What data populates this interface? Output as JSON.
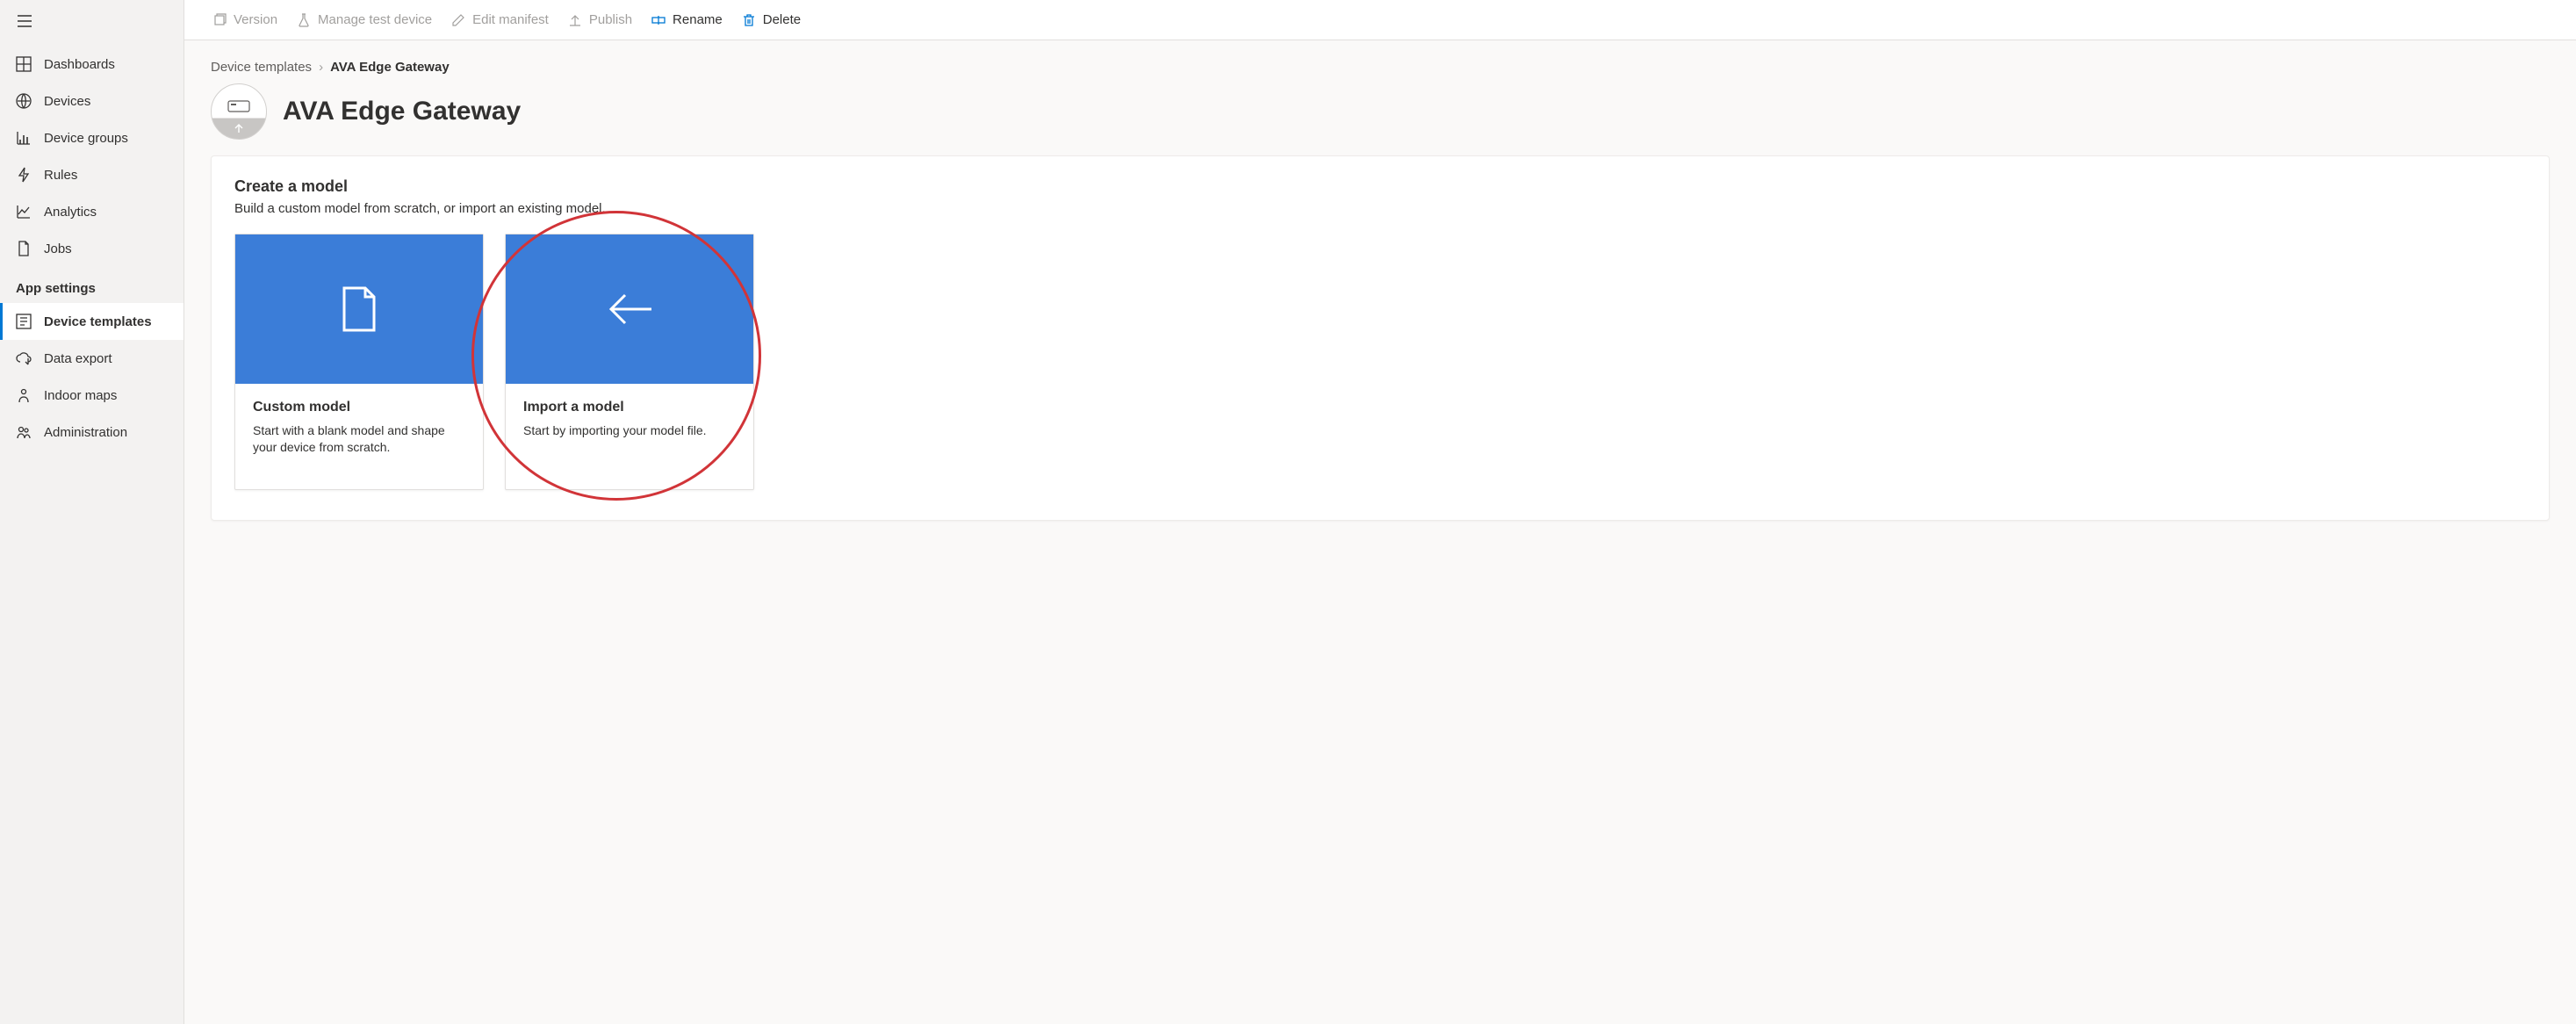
{
  "sidebar": {
    "heading": "App settings",
    "items": [
      {
        "label": "Dashboards"
      },
      {
        "label": "Devices"
      },
      {
        "label": "Device groups"
      },
      {
        "label": "Rules"
      },
      {
        "label": "Analytics"
      },
      {
        "label": "Jobs"
      }
    ],
    "app_settings": [
      {
        "label": "Device templates"
      },
      {
        "label": "Data export"
      },
      {
        "label": "Indoor maps"
      },
      {
        "label": "Administration"
      }
    ]
  },
  "toolbar": {
    "version": "Version",
    "manage": "Manage test device",
    "edit": "Edit manifest",
    "publish": "Publish",
    "rename": "Rename",
    "delete": "Delete"
  },
  "breadcrumb": {
    "root": "Device templates",
    "current": "AVA Edge Gateway"
  },
  "page": {
    "title": "AVA Edge Gateway"
  },
  "panel": {
    "title": "Create a model",
    "subtitle": "Build a custom model from scratch, or import an existing model.",
    "cards": [
      {
        "title": "Custom model",
        "desc": "Start with a blank model and shape your device from scratch."
      },
      {
        "title": "Import a model",
        "desc": "Start by importing your model file."
      }
    ]
  }
}
